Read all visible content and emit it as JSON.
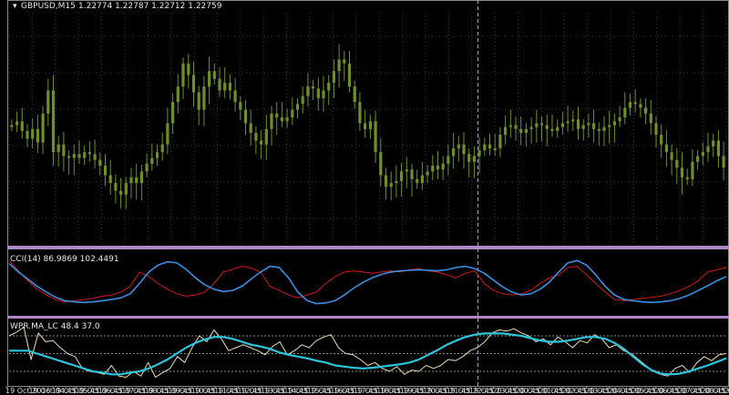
{
  "header": {
    "symbol_tf": "GBPUSD,M15",
    "ohlc": "1.22774 1.22787 1.22712 1.22759"
  },
  "colors": {
    "candle": "#6f8f2a",
    "grid": "#3a3a3a",
    "cci_red": "#d01818",
    "cci_blue": "#3c8ee0",
    "wpr_line": "#f0deb0",
    "wpr_ma": "#2cc6dc",
    "separator": "#b088c8",
    "crosshair": "#b0a0c0"
  },
  "cci_panel": {
    "label": "CCI(14) 86.9869 102.4491"
  },
  "wpr_panel": {
    "label": "WPR.MA_LC 48.4 37.0"
  },
  "chart_data": [
    {
      "type": "candlestick",
      "title": "GBPUSD,M15",
      "x_labels": [
        "19 Oct 2016",
        "19 Oct 04:45",
        "19 Oct 05:45",
        "19 Oct 06:45",
        "19 Oct 07:45",
        "19 Oct 08:45",
        "19 Oct 09:45",
        "19 Oct 10:45",
        "19 Oct 11:45",
        "19 Oct 12:45",
        "19 Oct 13:45",
        "19 Oct 14:45",
        "19 Oct 15:45",
        "19 Oct 16:45",
        "19 Oct 17:45",
        "19 Oct 18:45",
        "19 Oct 19:45",
        "19 Oct 20:45",
        "19 Oct 21:45",
        "19 Oct 22:45",
        "19 Oct 23:45",
        "20 Oct 00:45",
        "20 Oct 01:45",
        "20 Oct 02:45",
        "20 Oct 03:45",
        "20 Oct 04:45",
        "20 Oct 05:45",
        "20 Oct 06:45",
        "20 Oct 07:45",
        "20 Oct 08:45",
        "20 Oct 09:45",
        "20 Oct"
      ],
      "series_close": [
        0.54,
        0.56,
        0.51,
        0.47,
        0.52,
        0.45,
        0.6,
        0.72,
        0.4,
        0.44,
        0.38,
        0.37,
        0.39,
        0.37,
        0.4,
        0.39,
        0.36,
        0.33,
        0.28,
        0.24,
        0.2,
        0.18,
        0.24,
        0.27,
        0.24,
        0.3,
        0.34,
        0.37,
        0.4,
        0.44,
        0.55,
        0.66,
        0.74,
        0.86,
        0.8,
        0.71,
        0.62,
        0.74,
        0.82,
        0.78,
        0.72,
        0.76,
        0.72,
        0.66,
        0.62,
        0.55,
        0.5,
        0.46,
        0.44,
        0.52,
        0.6,
        0.58,
        0.56,
        0.58,
        0.62,
        0.65,
        0.69,
        0.74,
        0.73,
        0.68,
        0.72,
        0.76,
        0.82,
        0.88,
        0.86,
        0.74,
        0.66,
        0.55,
        0.52,
        0.56,
        0.4,
        0.28,
        0.22,
        0.24,
        0.25,
        0.3,
        0.31,
        0.26,
        0.24,
        0.28,
        0.3,
        0.33,
        0.31,
        0.34,
        0.38,
        0.42,
        0.44,
        0.39,
        0.35,
        0.38,
        0.41,
        0.44,
        0.42,
        0.42,
        0.49,
        0.53,
        0.54,
        0.52,
        0.5,
        0.52,
        0.53,
        0.55,
        0.54,
        0.52,
        0.51,
        0.53,
        0.55,
        0.56,
        0.57,
        0.52,
        0.54,
        0.55,
        0.52,
        0.51,
        0.53,
        0.54,
        0.56,
        0.58,
        0.63,
        0.66,
        0.65,
        0.63,
        0.6,
        0.55,
        0.49,
        0.44,
        0.4,
        0.36,
        0.32,
        0.27,
        0.26,
        0.35,
        0.38,
        0.4,
        0.43,
        0.46,
        0.38,
        0.32
      ],
      "ylim": [
        0,
        1
      ]
    },
    {
      "type": "line",
      "title": "CCI(14) 86.9869 102.4491",
      "series": [
        {
          "color": "#d01818",
          "values": [
            0.9,
            0.72,
            0.55,
            0.4,
            0.3,
            0.22,
            0.18,
            0.2,
            0.22,
            0.24,
            0.28,
            0.3,
            0.35,
            0.45,
            0.7,
            0.62,
            0.5,
            0.4,
            0.32,
            0.28,
            0.3,
            0.35,
            0.5,
            0.7,
            0.75,
            0.8,
            0.77,
            0.7,
            0.45,
            0.38,
            0.3,
            0.25,
            0.3,
            0.35,
            0.5,
            0.62,
            0.7,
            0.72,
            0.7,
            0.68,
            0.7,
            0.72,
            0.7,
            0.74,
            0.76,
            0.72,
            0.7,
            0.65,
            0.6,
            0.68,
            0.72,
            0.5,
            0.38,
            0.32,
            0.3,
            0.32,
            0.38,
            0.5,
            0.6,
            0.65,
            0.78,
            0.8,
            0.65,
            0.5,
            0.35,
            0.22,
            0.2,
            0.22,
            0.24,
            0.26,
            0.28,
            0.32,
            0.38,
            0.45,
            0.55,
            0.7,
            0.74,
            0.78
          ]
        },
        {
          "color": "#3c8ee0",
          "values": [
            0.85,
            0.7,
            0.58,
            0.45,
            0.35,
            0.26,
            0.2,
            0.18,
            0.17,
            0.18,
            0.2,
            0.22,
            0.25,
            0.32,
            0.5,
            0.7,
            0.82,
            0.88,
            0.86,
            0.75,
            0.6,
            0.48,
            0.4,
            0.36,
            0.38,
            0.45,
            0.58,
            0.7,
            0.8,
            0.78,
            0.6,
            0.35,
            0.2,
            0.15,
            0.16,
            0.2,
            0.3,
            0.42,
            0.52,
            0.6,
            0.66,
            0.7,
            0.72,
            0.73,
            0.74,
            0.73,
            0.72,
            0.74,
            0.78,
            0.8,
            0.76,
            0.68,
            0.56,
            0.44,
            0.35,
            0.3,
            0.32,
            0.4,
            0.52,
            0.7,
            0.86,
            0.9,
            0.82,
            0.65,
            0.45,
            0.3,
            0.22,
            0.2,
            0.18,
            0.17,
            0.18,
            0.2,
            0.24,
            0.3,
            0.38,
            0.46,
            0.55,
            0.62
          ]
        }
      ]
    },
    {
      "type": "line",
      "title": "WPR.MA_LC 48.4 37.0",
      "levels": [
        20,
        50,
        80
      ],
      "series": [
        {
          "color": "#f0deb0",
          "values": [
            80,
            86,
            95,
            40,
            85,
            70,
            72,
            60,
            50,
            45,
            25,
            20,
            18,
            15,
            30,
            12,
            10,
            20,
            12,
            35,
            10,
            18,
            25,
            45,
            35,
            60,
            80,
            70,
            90,
            75,
            55,
            60,
            65,
            60,
            55,
            48,
            62,
            70,
            48,
            55,
            65,
            60,
            72,
            78,
            82,
            60,
            50,
            48,
            40,
            30,
            35,
            25,
            20,
            28,
            15,
            22,
            20,
            30,
            25,
            30,
            40,
            38,
            45,
            55,
            60,
            70,
            85,
            90,
            88,
            92,
            85,
            80,
            70,
            75,
            65,
            78,
            70,
            60,
            72,
            68,
            82,
            75,
            60,
            65,
            55,
            50,
            40,
            30,
            20,
            15,
            12,
            25,
            30,
            18,
            35,
            45,
            38,
            48,
            50
          ]
        },
        {
          "color": "#2cc6dc",
          "values": [
            55,
            55,
            55,
            50,
            45,
            40,
            35,
            30,
            25,
            20,
            18,
            15,
            15,
            18,
            20,
            25,
            32,
            40,
            50,
            60,
            68,
            74,
            78,
            78,
            75,
            70,
            65,
            62,
            58,
            52,
            48,
            45,
            42,
            38,
            35,
            30,
            28,
            26,
            25,
            26,
            28,
            30,
            32,
            35,
            40,
            48,
            56,
            65,
            72,
            78,
            82,
            84,
            84,
            84,
            82,
            80,
            76,
            72,
            70,
            70,
            72,
            75,
            78,
            78,
            75,
            68,
            58,
            45,
            32,
            22,
            16,
            15,
            16,
            20,
            25,
            30,
            36,
            42
          ]
        }
      ]
    }
  ]
}
